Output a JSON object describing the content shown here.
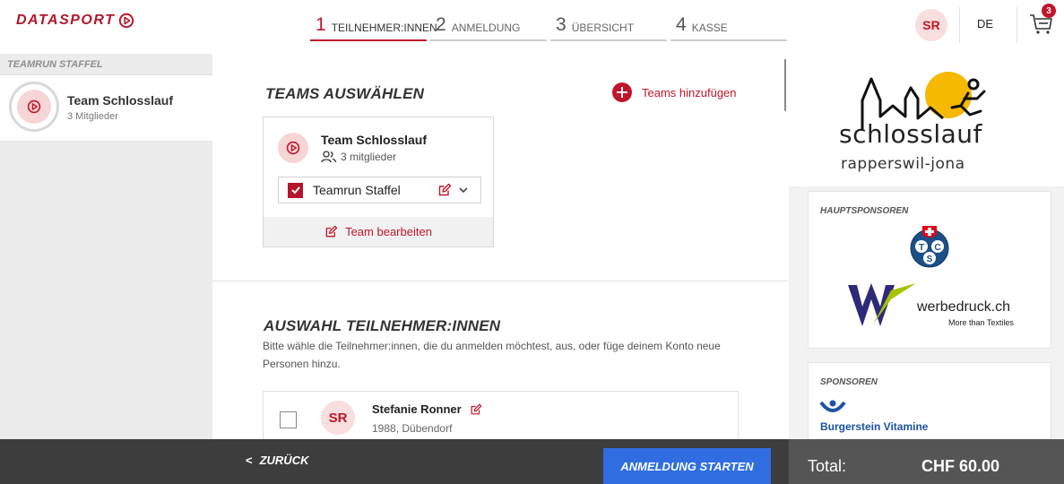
{
  "header": {
    "logo_text": "DATASPORT",
    "steps": [
      {
        "num": "1",
        "label": "TEILNEHMER:INNEN"
      },
      {
        "num": "2",
        "label": "ANMELDUNG"
      },
      {
        "num": "3",
        "label": "ÜBERSICHT"
      },
      {
        "num": "4",
        "label": "KASSE"
      }
    ],
    "active_step": 1,
    "user_initials": "SR",
    "language": "DE",
    "cart_count": "3"
  },
  "sidebar": {
    "title": "TEAMRUN STAFFEL",
    "team_name": "Team Schlosslauf",
    "team_members": "3 Mitglieder"
  },
  "teams": {
    "title": "TEAMS AUSWÄHLEN",
    "add_label": "Teams hinzufügen",
    "card": {
      "name": "Team Schlosslauf",
      "members": "3 mitglieder",
      "selection_label": "Teamrun Staffel",
      "selected": true,
      "edit_label": "Team bearbeiten"
    }
  },
  "participants": {
    "title": "AUSWAHL TEILNEHMER:INNEN",
    "description": "Bitte wähle die Teilnehmer:innen, die du anmelden möchtest, aus, oder füge deinem Konto neue Personen hinzu.",
    "items": [
      {
        "initials": "SR",
        "name": "Stefanie Ronner",
        "details": "1988, Dübendorf",
        "selected": false
      }
    ]
  },
  "right": {
    "brand_title": "schlosslauf",
    "brand_subtitle": "rapperswil-jona",
    "main_sponsors_label": "HAUPTSPONSOREN",
    "tcs_letters": [
      "T",
      "C",
      "S"
    ],
    "wb_name": "werbedruck.ch",
    "wb_tagline": "More than Textiles",
    "sponsors_label": "SPONSOREN",
    "burgerstein_name": "Burgerstein Vitamine"
  },
  "footer": {
    "back_label": "ZURÜCK",
    "start_label": "ANMELDUNG STARTEN",
    "total_label": "Total:",
    "total_value": "CHF 60.00"
  },
  "colors": {
    "brand_red": "#c0152a",
    "primary_blue": "#2f6de1",
    "footer_dark": "#3d3d3d",
    "sidebar_gray": "#ececec"
  }
}
